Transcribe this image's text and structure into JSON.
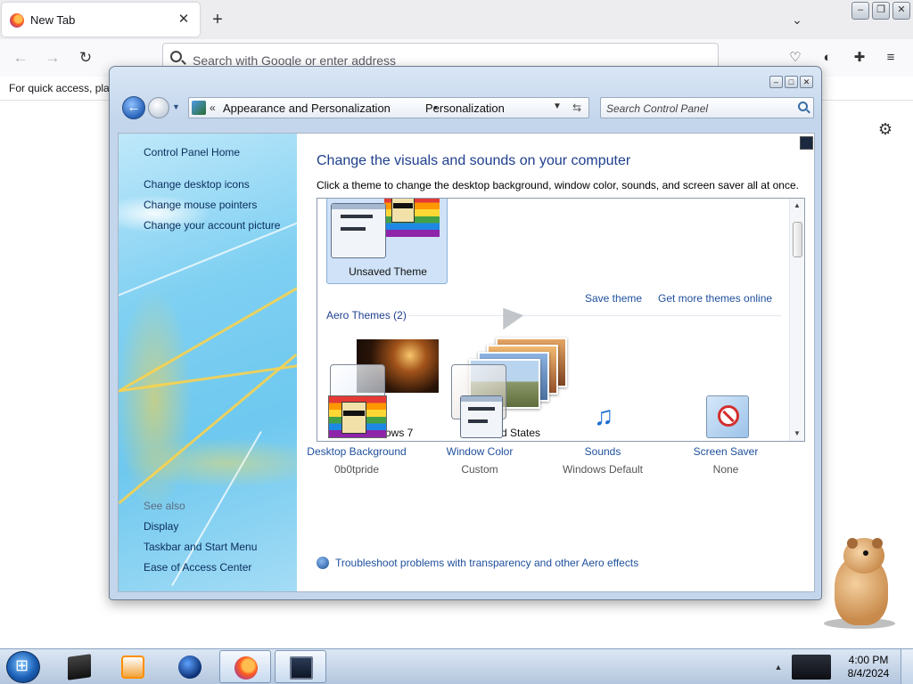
{
  "browser": {
    "tab": {
      "title": "New Tab",
      "close": "✕"
    },
    "new_tab": "+",
    "list_all_tabs": "⌄",
    "address_bar": {
      "placeholder": "Search with Google or enter address"
    },
    "bookmark_hint": "For quick access, plac",
    "window_controls": {
      "minimize": "–",
      "restore": "❐",
      "close": "✕"
    },
    "nav": {
      "back": "←",
      "forward": "→",
      "reload": "↻"
    },
    "toolbar_icons": {
      "pocket": "♡",
      "account": "◐",
      "extensions": "✚",
      "menu": "≡"
    },
    "settings": "⚙"
  },
  "control_panel": {
    "window_controls": {
      "minimize": "–",
      "maximize": "□",
      "close": "✕"
    },
    "breadcrumb": {
      "overflow": "«",
      "items": [
        "Appearance and Personalization",
        "Personalization"
      ],
      "separator": "•"
    },
    "search": {
      "placeholder": "Search Control Panel"
    },
    "sidebar": {
      "home": "Control Panel Home",
      "links": [
        "Change desktop icons",
        "Change mouse pointers",
        "Change your account picture"
      ],
      "see_also_title": "See also",
      "see_also": [
        "Display",
        "Taskbar and Start Menu",
        "Ease of Access Center"
      ]
    },
    "heading": "Change the visuals and sounds on your computer",
    "subheading": "Click a theme to change the desktop background, window color, sounds, and screen saver all at once.",
    "my_themes": {
      "unsaved": "Unsaved Theme"
    },
    "theme_links": {
      "save": "Save theme",
      "more": "Get more themes online"
    },
    "aero_group": {
      "title": "Aero Themes (2)",
      "themes": [
        "Windows 7",
        "United States"
      ]
    },
    "settings": [
      {
        "name": "Desktop Background",
        "value": "0b0tpride"
      },
      {
        "name": "Window Color",
        "value": "Custom"
      },
      {
        "name": "Sounds",
        "value": "Windows Default"
      },
      {
        "name": "Screen Saver",
        "value": "None"
      }
    ],
    "troubleshoot": "Troubleshoot problems with transparency and other Aero effects"
  },
  "taskbar": {
    "clock": {
      "time": "4:00 PM",
      "date": "8/4/2024"
    },
    "tray_expand": "▲"
  }
}
